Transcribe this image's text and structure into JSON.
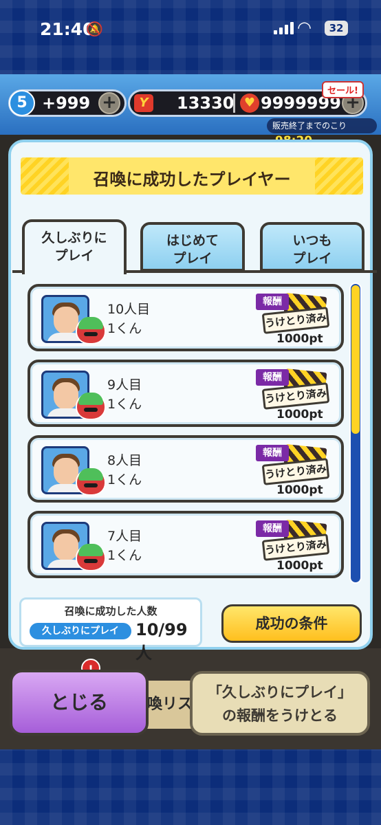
{
  "status_bar": {
    "time": "21:40",
    "battery": "32"
  },
  "currency": {
    "stamina_level": "5",
    "stamina_value": "+999",
    "ycoin_value": "13330",
    "gem_value": "9999999",
    "sale_label": "セール!",
    "timer_label": "販売終了までのこり",
    "timer_value": "98:20"
  },
  "modal": {
    "title": "召喚に成功したプレイヤー",
    "tabs": [
      {
        "line1": "久しぶりに",
        "line2": "プレイ"
      },
      {
        "line1": "はじめて",
        "line2": "プレイ"
      },
      {
        "line1": "いつも",
        "line2": "プレイ"
      }
    ],
    "rows": [
      {
        "count": "10人目",
        "name": "1くん",
        "reward_tag": "報酬",
        "status": "うけとり済み",
        "points": "1000pt"
      },
      {
        "count": "9人目",
        "name": "1くん",
        "reward_tag": "報酬",
        "status": "うけとり済み",
        "points": "1000pt"
      },
      {
        "count": "8人目",
        "name": "1くん",
        "reward_tag": "報酬",
        "status": "うけとり済み",
        "points": "1000pt"
      },
      {
        "count": "7人目",
        "name": "1くん",
        "reward_tag": "報酬",
        "status": "うけとり済み",
        "points": "1000pt"
      }
    ],
    "scroll_position": 0.0,
    "count_label": "召喚に成功した人数",
    "count_category": "久しぶりにプレイ",
    "count_value": "10/99人",
    "conditions_button": "成功の条件"
  },
  "bottom": {
    "close_button": "とじる",
    "background_text": "喚リス",
    "receive_line1": "「久しぶりにプレイ」",
    "receive_line2": "の報酬をうけとる",
    "badge": "!"
  }
}
